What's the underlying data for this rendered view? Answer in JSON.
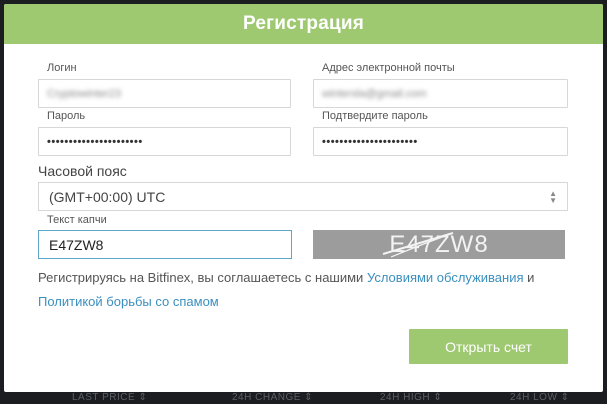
{
  "dialog": {
    "title": "Регистрация"
  },
  "form": {
    "login_label": "Логин",
    "login_value": "Cryptowinter23",
    "email_label": "Адрес электронной почты",
    "email_value": "wintersla@gmail.com",
    "password_label": "Пароль",
    "password_value": "••••••••••••••••••••••",
    "confirm_label": "Подтвердите пароль",
    "confirm_value": "••••••••••••••••••••••",
    "timezone_label": "Часовой пояс",
    "timezone_value": "(GMT+00:00) UTC",
    "captcha_label": "Текст капчи",
    "captcha_value": "E47ZW8",
    "captcha_image_text": "E47ZW8"
  },
  "terms": {
    "prefix": "Регистрируясь на Bitfinex, вы соглашаетесь с нашими ",
    "tos_link": "Условиями обслуживания",
    "middle": " и",
    "spam_link": "Политикой борьбы со спамом"
  },
  "submit_label": "Открыть счет",
  "background": {
    "footer_items": [
      "LAST PRICE ⇕",
      "24H CHANGE ⇕",
      "24H HIGH ⇕",
      "24H LOW ⇕"
    ]
  },
  "colors": {
    "accent": "#9ec970",
    "link": "#3a8fbf",
    "captcha_bg": "#9c9c9c",
    "page_bg": "#1b1d20"
  }
}
